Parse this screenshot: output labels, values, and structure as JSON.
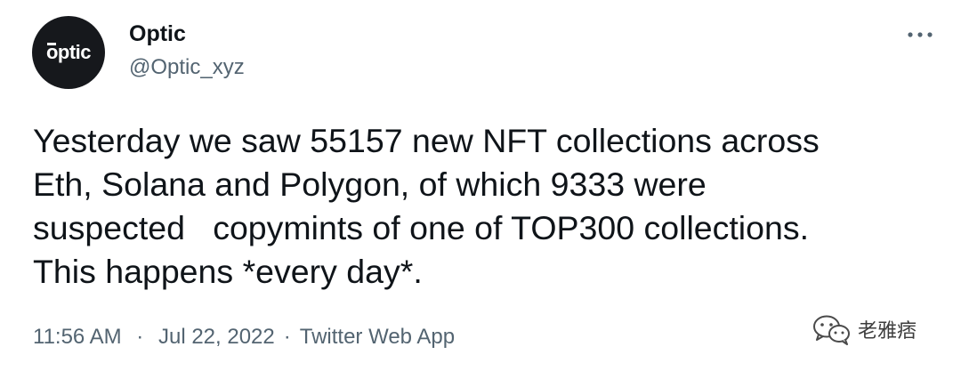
{
  "author": {
    "avatar_text": "optic",
    "display_name": "Optic",
    "handle": "@Optic_xyz"
  },
  "tweet": {
    "text_lines": [
      "Yesterday we saw 55157 new NFT collections across",
      "Eth, Solana and Polygon, of which 9333 were",
      "suspected   copymints of one of TOP300 collections.",
      "This happens *every day*."
    ],
    "time": "11:56 AM",
    "date": "Jul 22, 2022",
    "source": "Twitter Web App",
    "separator": "·"
  },
  "icons": {
    "more": "more-horizontal-icon",
    "watermark": "wechat-icon"
  },
  "watermark": {
    "text": "老雅痞"
  },
  "colors": {
    "text_primary": "#0f1419",
    "text_secondary": "#536471",
    "avatar_bg": "#16181c",
    "background": "#ffffff"
  }
}
